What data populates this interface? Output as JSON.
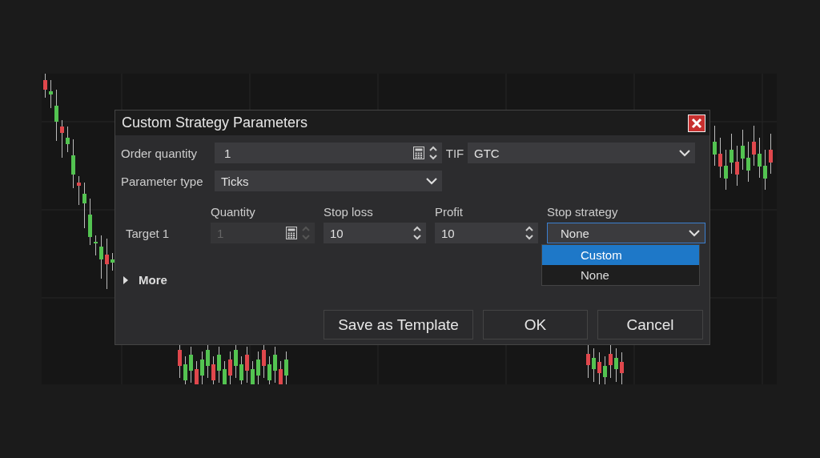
{
  "dialog": {
    "title": "Custom Strategy Parameters"
  },
  "order_quantity": {
    "label": "Order quantity",
    "value": "1"
  },
  "tif": {
    "label": "TIF",
    "value": "GTC"
  },
  "parameter_type": {
    "label": "Parameter type",
    "value": "Ticks"
  },
  "targets": {
    "columns": [
      "Quantity",
      "Stop loss",
      "Profit",
      "Stop strategy"
    ],
    "rows": [
      {
        "label": "Target 1",
        "quantity": "1",
        "quantity_disabled": true,
        "stop_loss": "10",
        "profit": "10",
        "stop_strategy": "None",
        "stop_strategy_focused": true
      }
    ]
  },
  "stop_strategy_dropdown": {
    "options": [
      {
        "label": "Custom",
        "selected": true
      },
      {
        "label": "None",
        "selected": false
      }
    ]
  },
  "more": {
    "label": "More",
    "expanded": false
  },
  "buttons": [
    "Save as Template",
    "OK",
    "Cancel"
  ]
}
